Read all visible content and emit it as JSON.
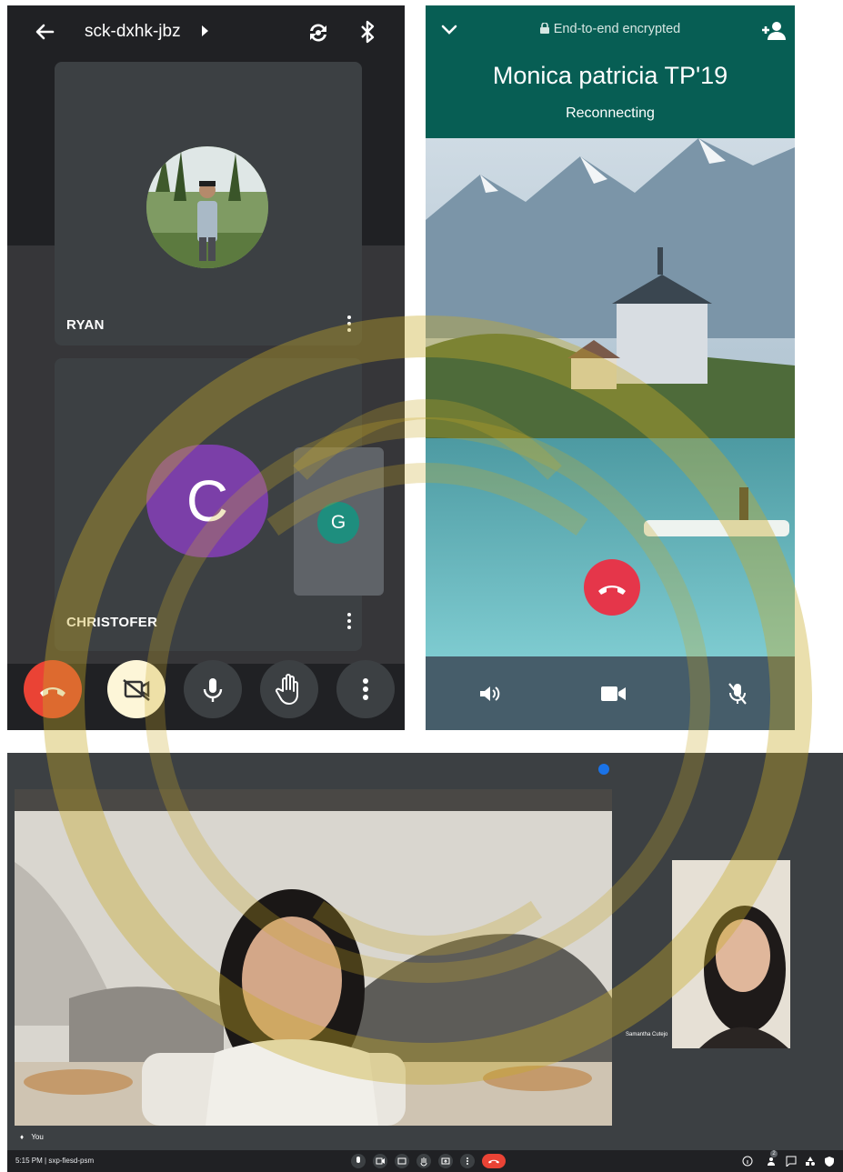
{
  "meet_mobile": {
    "meeting_code": "sck-dxhk-jbz",
    "participants": [
      {
        "name": "RYAN"
      },
      {
        "name": "CHRISTOFER",
        "initial": "C"
      }
    ],
    "self_initial": "G",
    "icons": [
      "back-arrow-icon",
      "switch-camera-icon",
      "bluetooth-icon",
      "hang-up-icon",
      "camera-off-icon",
      "microphone-icon",
      "raise-hand-icon",
      "more-options-icon"
    ],
    "colors": {
      "hangup": "#ea4335",
      "camera_off_bg": "#fdf6d8",
      "avatar_c": "#7b3fa8",
      "avatar_g": "#1e8e7e"
    }
  },
  "whatsapp_call": {
    "encryption_label": "End-to-end encrypted",
    "contact_name": "Monica patricia TP'19",
    "status": "Reconnecting",
    "icons": [
      "chevron-down-icon",
      "lock-icon",
      "add-participant-icon",
      "end-call-icon",
      "speaker-icon",
      "video-icon",
      "mic-muted-icon"
    ],
    "colors": {
      "header": "#075e54",
      "end_call": "#e5364a"
    }
  },
  "meet_desktop": {
    "time_and_code": "5:15 PM | sxp-fiesd-psm",
    "self_label": "You",
    "side_participant_name": "Samantha Cutejo",
    "participant_count": "2",
    "icons": [
      "mic-icon",
      "camera-icon",
      "captions-icon",
      "raise-hand-icon",
      "present-icon",
      "more-icon",
      "hang-up-icon",
      "info-icon",
      "people-icon",
      "chat-icon",
      "activities-icon",
      "host-controls-icon"
    ]
  }
}
